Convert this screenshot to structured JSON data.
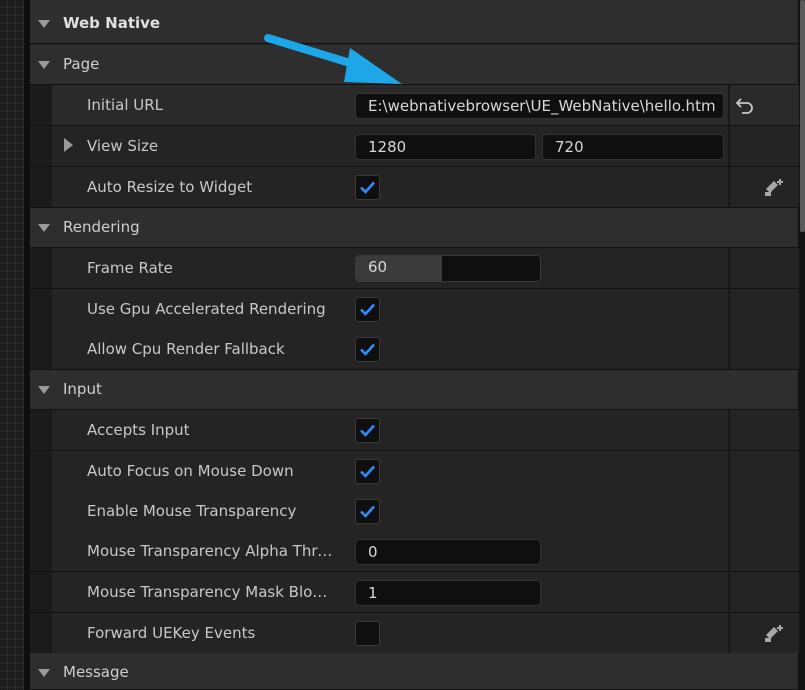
{
  "sections": {
    "web_native": "Web Native",
    "page": "Page",
    "rendering": "Rendering",
    "input": "Input",
    "message": "Message"
  },
  "properties": {
    "initial_url": {
      "label": "Initial URL",
      "value": "E:\\webnativebrowser\\UE_WebNative\\hello.htm"
    },
    "view_size": {
      "label": "View Size",
      "x": "1280",
      "y": "720"
    },
    "auto_resize": {
      "label": "Auto Resize to Widget",
      "checked": true
    },
    "frame_rate": {
      "label": "Frame Rate",
      "value": "60",
      "slider_fraction": 0.47
    },
    "gpu_rendering": {
      "label": "Use Gpu Accelerated Rendering",
      "checked": true
    },
    "cpu_fallback": {
      "label": "Allow Cpu Render Fallback",
      "checked": true
    },
    "accepts_input": {
      "label": "Accepts Input",
      "checked": true
    },
    "auto_focus": {
      "label": "Auto Focus on Mouse Down",
      "checked": true
    },
    "mouse_transparency": {
      "label": "Enable Mouse Transparency",
      "checked": true
    },
    "alpha_threshold": {
      "label": "Mouse Transparency Alpha Thre…",
      "value": "0"
    },
    "mask_block": {
      "label": "Mouse Transparency Mask Bloc…",
      "value": "1"
    },
    "forward_uekey": {
      "label": "Forward UEKey Events",
      "checked": false
    }
  },
  "icons": {
    "reset": "reset-to-default-icon",
    "link": "property-binding-icon",
    "arrow": "annotation-arrow-icon",
    "check": "checkmark-icon"
  },
  "colors": {
    "accent_check": "#2f8cff",
    "annotation_arrow": "#1ea7e8"
  }
}
